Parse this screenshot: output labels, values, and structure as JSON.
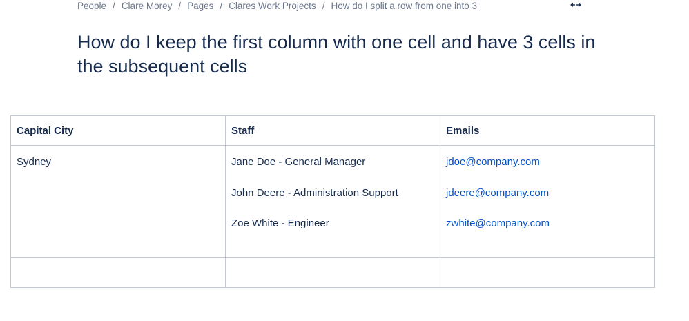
{
  "breadcrumb": {
    "items": [
      "People",
      "Clare Morey",
      "Pages",
      "Clares Work Projects",
      "How do I split a row from one into 3"
    ],
    "separator": "/"
  },
  "page": {
    "title": "How do I keep the first column with one cell and have 3 cells in the subsequent cells"
  },
  "table": {
    "headers": [
      "Capital City",
      "Staff",
      "Emails"
    ],
    "row": {
      "city": "Sydney",
      "staff": [
        "Jane Doe - General Manager",
        "John Deere - Administration Support",
        "Zoe White - Engineer"
      ],
      "emails": [
        "jdoe@company.com",
        "jdeere@company.com",
        "zwhite@company.com"
      ]
    }
  },
  "icons": {
    "expand": "expand-width-icon"
  },
  "colors": {
    "text": "#172b4d",
    "muted": "#6b778c",
    "link": "#0052cc",
    "border": "#c1c7d0"
  }
}
